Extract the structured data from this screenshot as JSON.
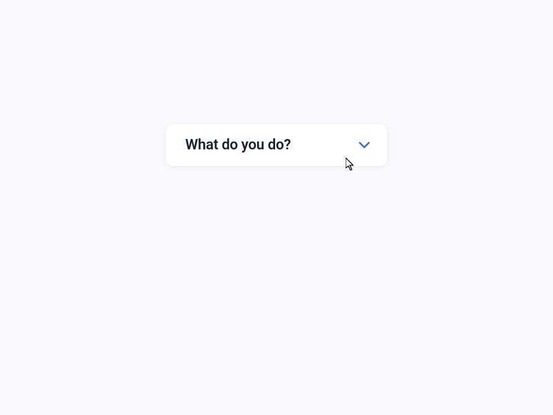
{
  "dropdown": {
    "label": "What do you do?",
    "chevron_color": "#3b6fd1"
  }
}
